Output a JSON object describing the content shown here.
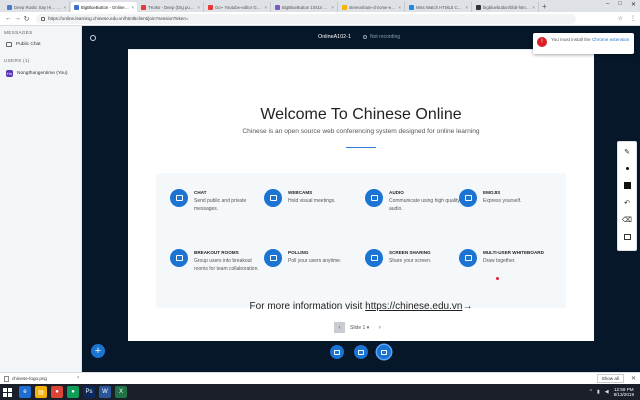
{
  "browser": {
    "tabs": [
      {
        "title": "Deep Rustic Say Hi… Full",
        "active": false,
        "favicon_color": "#4a7bd0"
      },
      {
        "title": "BigBlueButton - OnlineA1",
        "active": true,
        "favicon_color": "#3f6fd1"
      },
      {
        "title": "TKoks - Deep (Drg public…",
        "active": false,
        "favicon_color": "#e53935"
      },
      {
        "title": "Go~ Youtube-editor Gmail…",
        "active": false,
        "favicon_color": "#e53935"
      },
      {
        "title": "BigBlueButton 1041s sod",
        "active": false,
        "favicon_color": "#7e57c2"
      },
      {
        "title": "stereoshare-chrome-extens…",
        "active": false,
        "favicon_color": "#f4b400"
      },
      {
        "title": "Miss Watch HTML5 Chrome",
        "active": false,
        "favicon_color": "#1e88e5"
      },
      {
        "title": "bigbluebutton/bbb-html5…",
        "active": false,
        "favicon_color": "#333333"
      }
    ],
    "new_tab_symbol": "+",
    "window_controls": [
      "–",
      "□",
      "✕"
    ],
    "nav": {
      "back": "←",
      "forward": "→",
      "reload": "↻"
    },
    "url": "https://online.learning.chinese.edu.vn/html5client/join?sessionToken=",
    "toolbar_icons": [
      "☆",
      "⋮"
    ]
  },
  "left_panel": {
    "messages_title": "MESSAGES",
    "public_chat_label": "Public Chat",
    "users_title": "USERS (1)",
    "user": {
      "initials": "Ho",
      "name": "Nongthangentime (You)",
      "avatar_color": "#5b36b0"
    }
  },
  "topbar": {
    "meeting_title": "OnlineA102-1",
    "recording_label": "Not recording"
  },
  "slide": {
    "title": "Welcome To Chinese Online",
    "subtitle": "Chinese is an open source web conferencing system designed for online learning",
    "features": [
      {
        "name": "CHAT",
        "desc": "Send public and private messages."
      },
      {
        "name": "WEBCAMS",
        "desc": "Hold visual meetings."
      },
      {
        "name": "AUDIO",
        "desc": "Communicate using high quality audio."
      },
      {
        "name": "EMOJIS",
        "desc": "Express yourself."
      },
      {
        "name": "BREAKOUT ROOMS",
        "desc": "Group users into breakout rooms for team collaboration."
      },
      {
        "name": "POLLING",
        "desc": "Poll your users anytime."
      },
      {
        "name": "SCREEN SHARING",
        "desc": "Share your screen."
      },
      {
        "name": "MULTI-USER WHITEBOARD",
        "desc": "Draw together."
      }
    ],
    "footer_text": "For more information visit ",
    "footer_link": "https://chinese.edu.vn",
    "footer_arrow": "→"
  },
  "slide_nav": {
    "prev": "‹",
    "current": "Slide 1",
    "caret": "▾",
    "next": "›"
  },
  "notification": {
    "icon": "!",
    "text": "You must install the",
    "link": "Chrome extension"
  },
  "whiteboard_tools": [
    "✎",
    "dot",
    "square",
    "↶",
    "⌫",
    "box"
  ],
  "downloads": {
    "file": "chinese-logo.png",
    "show_all": "Show all",
    "close": "✕"
  },
  "taskbar": {
    "apps": [
      {
        "label": "e",
        "color": "#1e6fd1"
      },
      {
        "label": "▤",
        "color": "#f2b10b"
      },
      {
        "label": "●",
        "color": "#db4437"
      },
      {
        "label": "●",
        "color": "#0f9d58"
      },
      {
        "label": "Ps",
        "color": "#0b2a5b"
      },
      {
        "label": "W",
        "color": "#2b579a"
      },
      {
        "label": "X",
        "color": "#217346"
      }
    ],
    "time": "12:59 PM",
    "date": "8/13/2019"
  },
  "colors": {
    "accent": "#1b73d2",
    "stage": "#06172a"
  }
}
